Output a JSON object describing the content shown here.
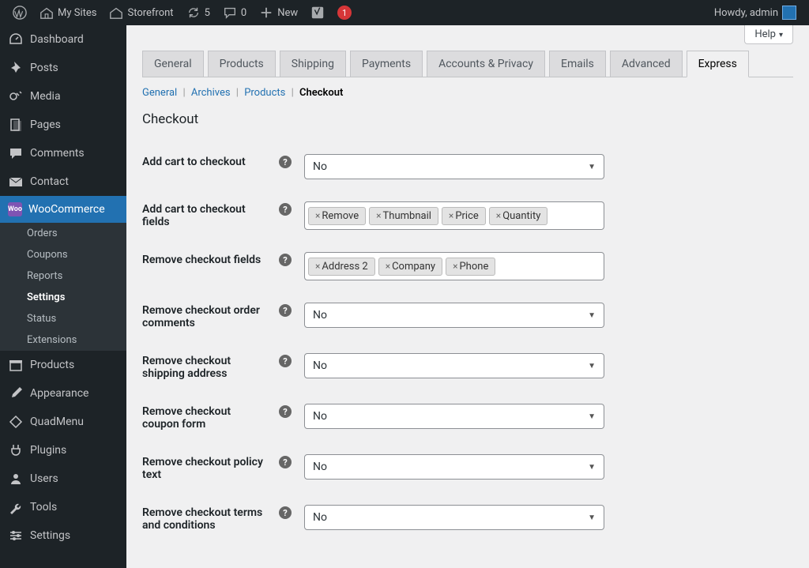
{
  "toolbar": {
    "my_sites": "My Sites",
    "site_name": "Storefront",
    "updates_count": "5",
    "comments_count": "0",
    "new_label": "New",
    "notif_count": "1",
    "howdy": "Howdy, admin"
  },
  "sidebar": {
    "items": [
      {
        "label": "Dashboard",
        "icon": "dashboard"
      },
      {
        "label": "Posts",
        "icon": "pin"
      },
      {
        "label": "Media",
        "icon": "media"
      },
      {
        "label": "Pages",
        "icon": "pages"
      },
      {
        "label": "Comments",
        "icon": "comment"
      },
      {
        "label": "Contact",
        "icon": "mail"
      },
      {
        "label": "WooCommerce",
        "icon": "woo",
        "active": true
      },
      {
        "label": "Products",
        "icon": "archive"
      },
      {
        "label": "Appearance",
        "icon": "brush"
      },
      {
        "label": "QuadMenu",
        "icon": "diamond"
      },
      {
        "label": "Plugins",
        "icon": "plug"
      },
      {
        "label": "Users",
        "icon": "users"
      },
      {
        "label": "Tools",
        "icon": "tools"
      },
      {
        "label": "Settings",
        "icon": "sliders"
      }
    ],
    "submenu": [
      {
        "label": "Orders"
      },
      {
        "label": "Coupons"
      },
      {
        "label": "Reports"
      },
      {
        "label": "Settings",
        "active": true
      },
      {
        "label": "Status"
      },
      {
        "label": "Extensions"
      }
    ]
  },
  "page": {
    "help_label": "Help",
    "tabs": [
      "General",
      "Products",
      "Shipping",
      "Payments",
      "Accounts & Privacy",
      "Emails",
      "Advanced",
      "Express"
    ],
    "active_tab": "Express",
    "subtabs": {
      "links": [
        "General",
        "Archives",
        "Products"
      ],
      "current": "Checkout"
    },
    "heading": "Checkout"
  },
  "form": {
    "rows": [
      {
        "label": "Add cart to checkout",
        "type": "select",
        "value": "No"
      },
      {
        "label": "Add cart to checkout fields",
        "type": "tags",
        "tags": [
          "Remove",
          "Thumbnail",
          "Price",
          "Quantity"
        ]
      },
      {
        "label": "Remove checkout fields",
        "type": "tags",
        "tags": [
          "Address 2",
          "Company",
          "Phone"
        ]
      },
      {
        "label": "Remove checkout order comments",
        "type": "select",
        "value": "No"
      },
      {
        "label": "Remove checkout shipping address",
        "type": "select",
        "value": "No"
      },
      {
        "label": "Remove checkout coupon form",
        "type": "select",
        "value": "No"
      },
      {
        "label": "Remove checkout policy text",
        "type": "select",
        "value": "No"
      },
      {
        "label": "Remove checkout terms and conditions",
        "type": "select",
        "value": "No"
      }
    ]
  }
}
